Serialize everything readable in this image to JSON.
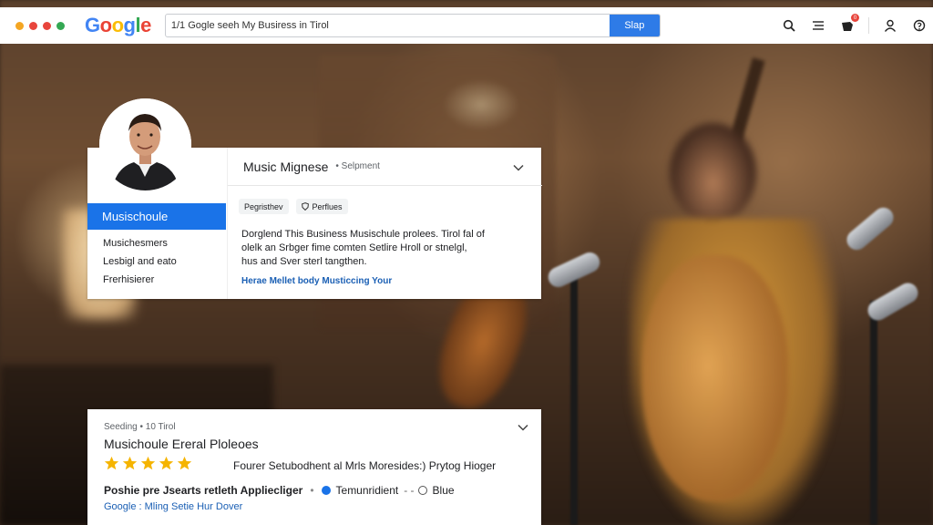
{
  "window": {
    "dot_colors": [
      "#f4a623",
      "#e8453c",
      "#e8453c",
      "#34a853"
    ]
  },
  "browser": {
    "logo": {
      "letters": [
        "G",
        "o",
        "o",
        "g",
        "l",
        "e"
      ],
      "colors": [
        "#4285f4",
        "#ea4335",
        "#fbbc05",
        "#4285f4",
        "#34a853",
        "#ea4335"
      ]
    },
    "search": {
      "value": "1/1 Gogle seeh My Busiress in Tirol",
      "button_label": "Slap"
    },
    "icons": [
      "search-icon",
      "menu-icon",
      "notification-icon",
      "user-icon",
      "more-icon"
    ],
    "notification_badge": "0"
  },
  "profile_card": {
    "title": "Music Mignese",
    "subtitle": "Selpment",
    "categories": {
      "active": "Musischoule",
      "items": [
        "Musichesmers",
        "Lesbigl and eato",
        "Frerhisierer"
      ]
    },
    "chips": [
      {
        "label": "Pegristhev"
      },
      {
        "label": "Perflues",
        "icon": "shield-icon"
      }
    ],
    "description_lines": [
      "Dorglend This Business Musischule prolees. Tirol fal of",
      "olelk an Srbger fime comten Setlire Hroll or stnelgl,",
      "hus and Sver sterl tangthen."
    ],
    "link": "Herae Mellet body Musticcing Your"
  },
  "listing_card": {
    "meta": "Seeding • 10 Tirol",
    "title": "Musichoule Ereral Ploleoes",
    "rating": 5,
    "review": "Fourer Setubodhent al Mrls Moresides:) Prytog Hioger",
    "row_label": "Poshie pre Jsearts retleth Appliecliger",
    "row_mid": "Temunridient",
    "row_mid_suffix": "- -",
    "row_end": "Blue",
    "link": "Google : Mling Setie Hur Dover"
  }
}
